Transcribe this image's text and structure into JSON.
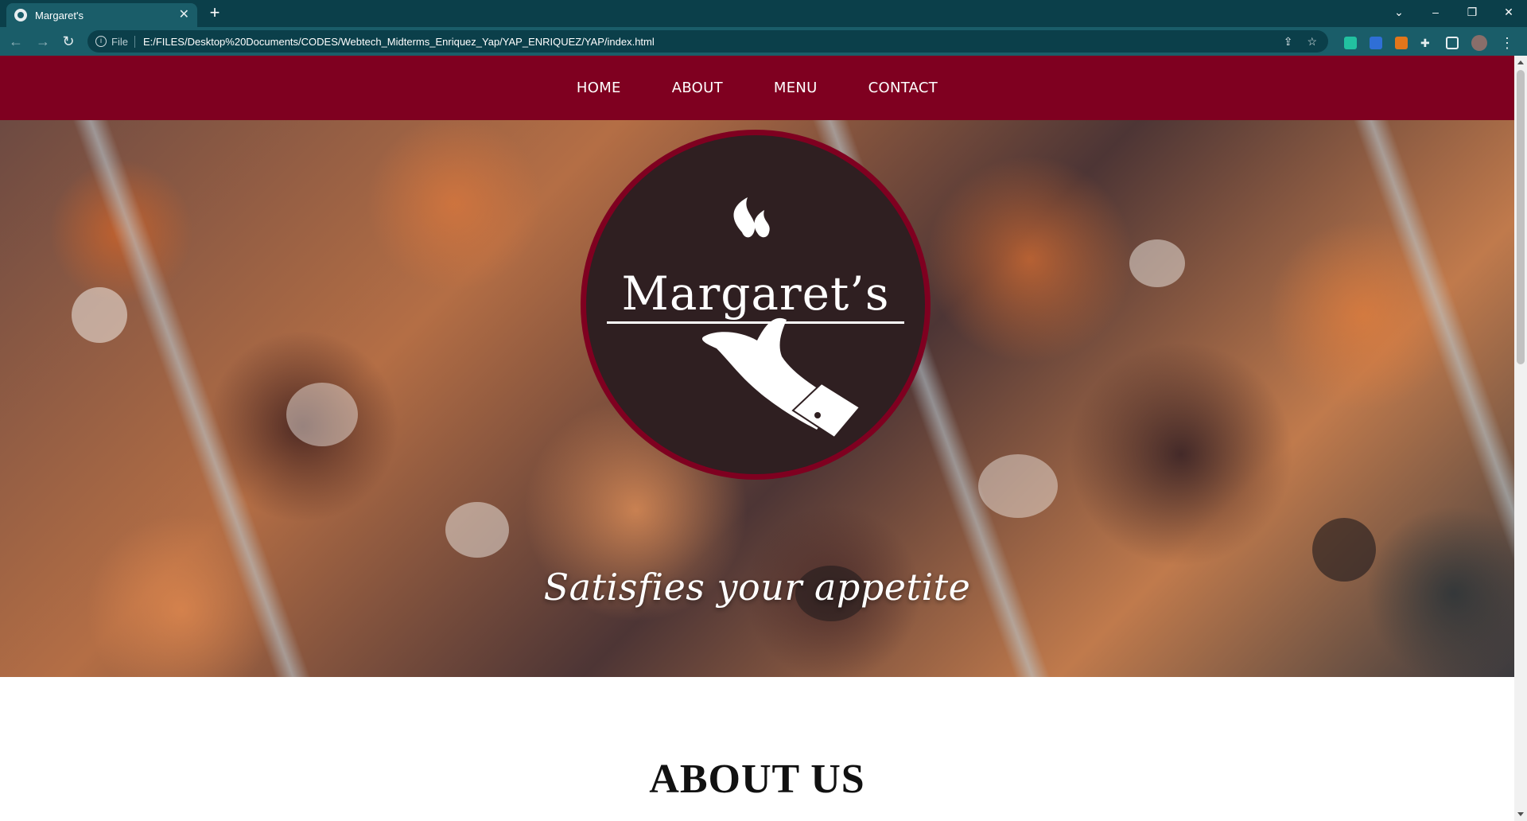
{
  "browser": {
    "tab_title": "Margaret's",
    "tab_close": "✕",
    "new_tab": "+",
    "omnibox": {
      "scheme_label": "File",
      "url": "E:/FILES/Desktop%20Documents/CODES/Webtech_Midterms_Enriquez_Yap/YAP_ENRIQUEZ/YAP/index.html"
    },
    "window_controls": {
      "minimize": "–",
      "restore": "❐",
      "close": "✕",
      "tab_search": "⌄"
    }
  },
  "site": {
    "nav": [
      "HOME",
      "ABOUT",
      "MENU",
      "CONTACT"
    ],
    "logo_text": "Margaret’s",
    "tagline": "Satisfies your appetite",
    "about_heading": "ABOUT US"
  },
  "colors": {
    "brand": "#7f0020",
    "logo_bg": "#2f1f21",
    "chrome_dark": "#0b3f4a",
    "chrome": "#1a5d69"
  }
}
